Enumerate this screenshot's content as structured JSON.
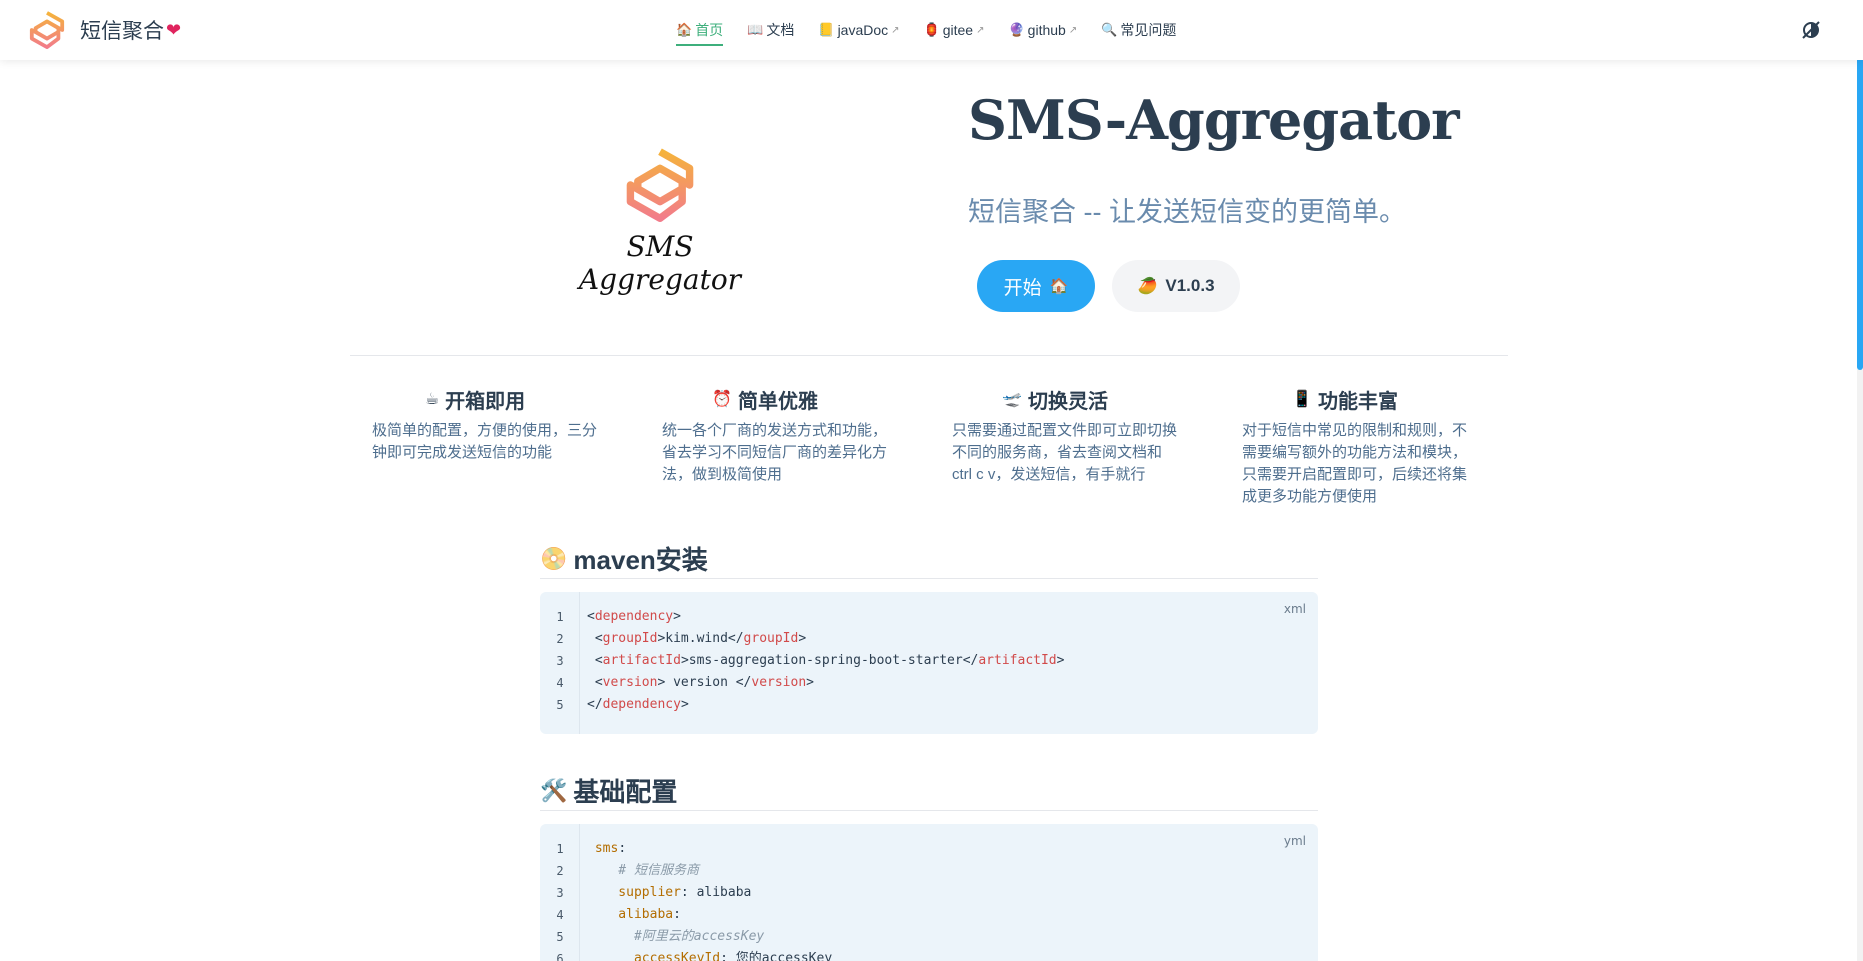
{
  "brand": {
    "title": "短信聚合"
  },
  "nav": {
    "items": [
      {
        "label": "首页",
        "icon": "🏠",
        "active": true,
        "external": false
      },
      {
        "label": "文档",
        "icon": "📖",
        "active": false,
        "external": false
      },
      {
        "label": "javaDoc",
        "icon": "📒",
        "active": false,
        "external": true
      },
      {
        "label": "gitee",
        "icon": "🏮",
        "active": false,
        "external": true
      },
      {
        "label": "github",
        "icon": "🔮",
        "active": false,
        "external": true
      },
      {
        "label": "常见问题",
        "icon": "🔍",
        "active": false,
        "external": false
      }
    ]
  },
  "hero": {
    "logo_text": "SMS Aggregator",
    "title": "SMS-Aggregator",
    "tagline": "短信聚合 -- 让发送短信变的更简单。",
    "start_label": "开始",
    "start_icon": "🏠",
    "version_label": "V1.0.3",
    "version_icon": "🥭"
  },
  "features": [
    {
      "icon": "☕",
      "title": "开箱即用",
      "desc": "极简单的配置，方便的使用，三分钟即可完成发送短信的功能"
    },
    {
      "icon": "⏰",
      "title": "简单优雅",
      "desc": "统一各个厂商的发送方式和功能，省去学习不同短信厂商的差异化方法，做到极简使用"
    },
    {
      "icon": "🛫",
      "title": "切换灵活",
      "desc": "只需要通过配置文件即可立即切换不同的服务商，省去查阅文档和ctrl c v，发送短信，有手就行"
    },
    {
      "icon": "📱",
      "title": "功能丰富",
      "desc": "对于短信中常见的限制和规则，不需要编写额外的功能方法和模块，只需要开启配置即可，后续还将集成更多功能方便使用"
    }
  ],
  "maven": {
    "icon": "📀",
    "title": "maven安装",
    "lang": "xml",
    "lines": [
      {
        "n": "1",
        "parts": [
          [
            "p",
            "<"
          ],
          [
            "t",
            "dependency"
          ],
          [
            "p",
            ">"
          ]
        ]
      },
      {
        "n": "2",
        "parts": [
          [
            "p",
            " <"
          ],
          [
            "t",
            "groupId"
          ],
          [
            "p",
            ">kim.wind</"
          ],
          [
            "t",
            "groupId"
          ],
          [
            "p",
            ">"
          ]
        ]
      },
      {
        "n": "3",
        "parts": [
          [
            "p",
            " <"
          ],
          [
            "t",
            "artifactId"
          ],
          [
            "p",
            ">sms-aggregation-spring-boot-starter</"
          ],
          [
            "t",
            "artifactId"
          ],
          [
            "p",
            ">"
          ]
        ]
      },
      {
        "n": "4",
        "parts": [
          [
            "p",
            " <"
          ],
          [
            "t",
            "version"
          ],
          [
            "p",
            "> version </"
          ],
          [
            "t",
            "version"
          ],
          [
            "p",
            ">"
          ]
        ]
      },
      {
        "n": "5",
        "parts": [
          [
            "p",
            "</"
          ],
          [
            "t",
            "dependency"
          ],
          [
            "p",
            ">"
          ]
        ]
      }
    ]
  },
  "config": {
    "icon": "🛠️",
    "title": "基础配置",
    "lang": "yml",
    "lines": [
      {
        "n": "1",
        "parts": [
          [
            "k",
            " sms"
          ],
          [
            "p",
            ":"
          ]
        ]
      },
      {
        "n": "2",
        "parts": [
          [
            "c",
            "    # 短信服务商"
          ]
        ]
      },
      {
        "n": "3",
        "parts": [
          [
            "k",
            "    supplier"
          ],
          [
            "p",
            ": alibaba"
          ]
        ]
      },
      {
        "n": "4",
        "parts": [
          [
            "k",
            "    alibaba"
          ],
          [
            "p",
            ":"
          ]
        ]
      },
      {
        "n": "5",
        "parts": [
          [
            "c",
            "      #阿里云的accessKey"
          ]
        ]
      },
      {
        "n": "6",
        "parts": [
          [
            "k",
            "      accessKeyId"
          ],
          [
            "p",
            ": 您的accessKey"
          ]
        ]
      }
    ]
  }
}
